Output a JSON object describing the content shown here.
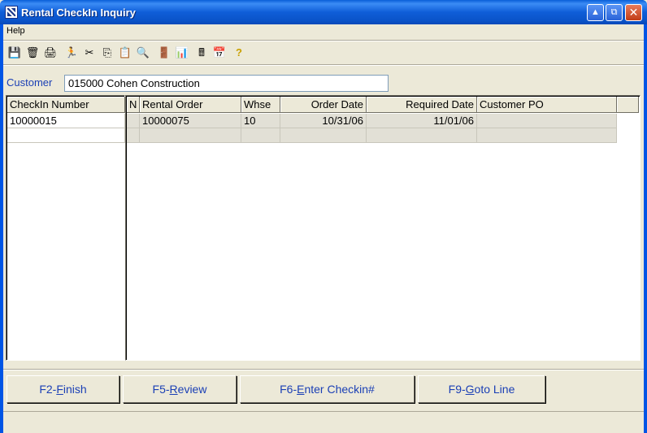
{
  "window": {
    "title": "Rental CheckIn Inquiry",
    "min_glyph": "▲",
    "max_glyph": "⧉",
    "close_glyph": "✕"
  },
  "menu": {
    "help": "Help"
  },
  "toolbar": {
    "icons": [
      "save-icon",
      "clear-icon",
      "print-icon",
      "exit-run-icon",
      "cut-icon",
      "copy-icon",
      "paste-icon",
      "find-icon",
      "door-icon",
      "chart-icon",
      "calculator-icon",
      "calendar-icon",
      "help-icon"
    ],
    "glyphs": [
      "💾",
      "🗑",
      "🖨",
      "🏃",
      "✂",
      "⎘",
      "📋",
      "🔍",
      "🚪",
      "📊",
      "🖩",
      "📅",
      "?"
    ]
  },
  "customer": {
    "label": "Customer",
    "value": "015000 Cohen Construction"
  },
  "left_grid": {
    "header": "CheckIn Number",
    "rows": [
      "10000015",
      ""
    ]
  },
  "right_grid": {
    "headers": [
      "N",
      "Rental Order",
      "Whse",
      "Order Date",
      "Required Date",
      "Customer PO"
    ],
    "rows": [
      [
        "",
        "10000075",
        "10",
        "10/31/06",
        "11/01/06",
        ""
      ],
      [
        "",
        "",
        "",
        "",
        "",
        ""
      ]
    ]
  },
  "buttons": {
    "finish_key": "F2-",
    "finish_ul": "F",
    "finish_rest": "inish",
    "review_key": "F5-",
    "review_ul": "R",
    "review_rest": "eview",
    "enter_key": "F6-",
    "enter_ul": "E",
    "enter_rest": "nter Checkin#",
    "goto_key": "F9-",
    "goto_ul": "G",
    "goto_rest": "oto Line"
  }
}
